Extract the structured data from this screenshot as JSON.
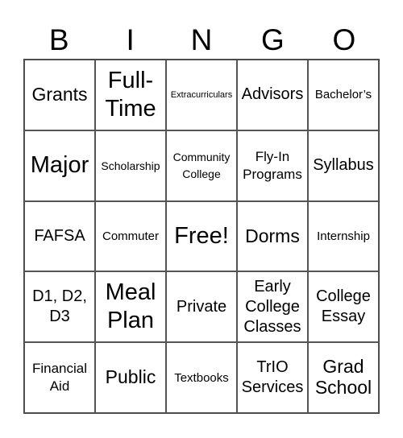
{
  "header": [
    "B",
    "I",
    "N",
    "G",
    "O"
  ],
  "cells": [
    {
      "text": "Grants",
      "size": "s-l"
    },
    {
      "text": "Full-Time",
      "size": "s-xl"
    },
    {
      "text": "Extracurriculars",
      "size": "s-xxs"
    },
    {
      "text": "Advisors",
      "size": "s-m"
    },
    {
      "text": "Bachelor’s",
      "size": "s-s"
    },
    {
      "text": "Major",
      "size": "s-xl"
    },
    {
      "text": "Scholarship",
      "size": "s-xs"
    },
    {
      "text": "Community College",
      "size": "s-xs"
    },
    {
      "text": "Fly-In Programs",
      "size": "s-sm"
    },
    {
      "text": "Syllabus",
      "size": "s-m"
    },
    {
      "text": "FAFSA",
      "size": "s-m"
    },
    {
      "text": "Commuter",
      "size": "s-s"
    },
    {
      "text": "Free!",
      "size": "s-xl"
    },
    {
      "text": "Dorms",
      "size": "s-l"
    },
    {
      "text": "Internship",
      "size": "s-s"
    },
    {
      "text": "D1, D2, D3",
      "size": "s-m"
    },
    {
      "text": "Meal Plan",
      "size": "s-xl"
    },
    {
      "text": "Private",
      "size": "s-m"
    },
    {
      "text": "Early College Classes",
      "size": "s-m"
    },
    {
      "text": "College Essay",
      "size": "s-m"
    },
    {
      "text": "Financial Aid",
      "size": "s-sm"
    },
    {
      "text": "Public",
      "size": "s-l"
    },
    {
      "text": "Textbooks",
      "size": "s-s"
    },
    {
      "text": "TrIO Services",
      "size": "s-m"
    },
    {
      "text": "Grad School",
      "size": "s-l"
    }
  ]
}
